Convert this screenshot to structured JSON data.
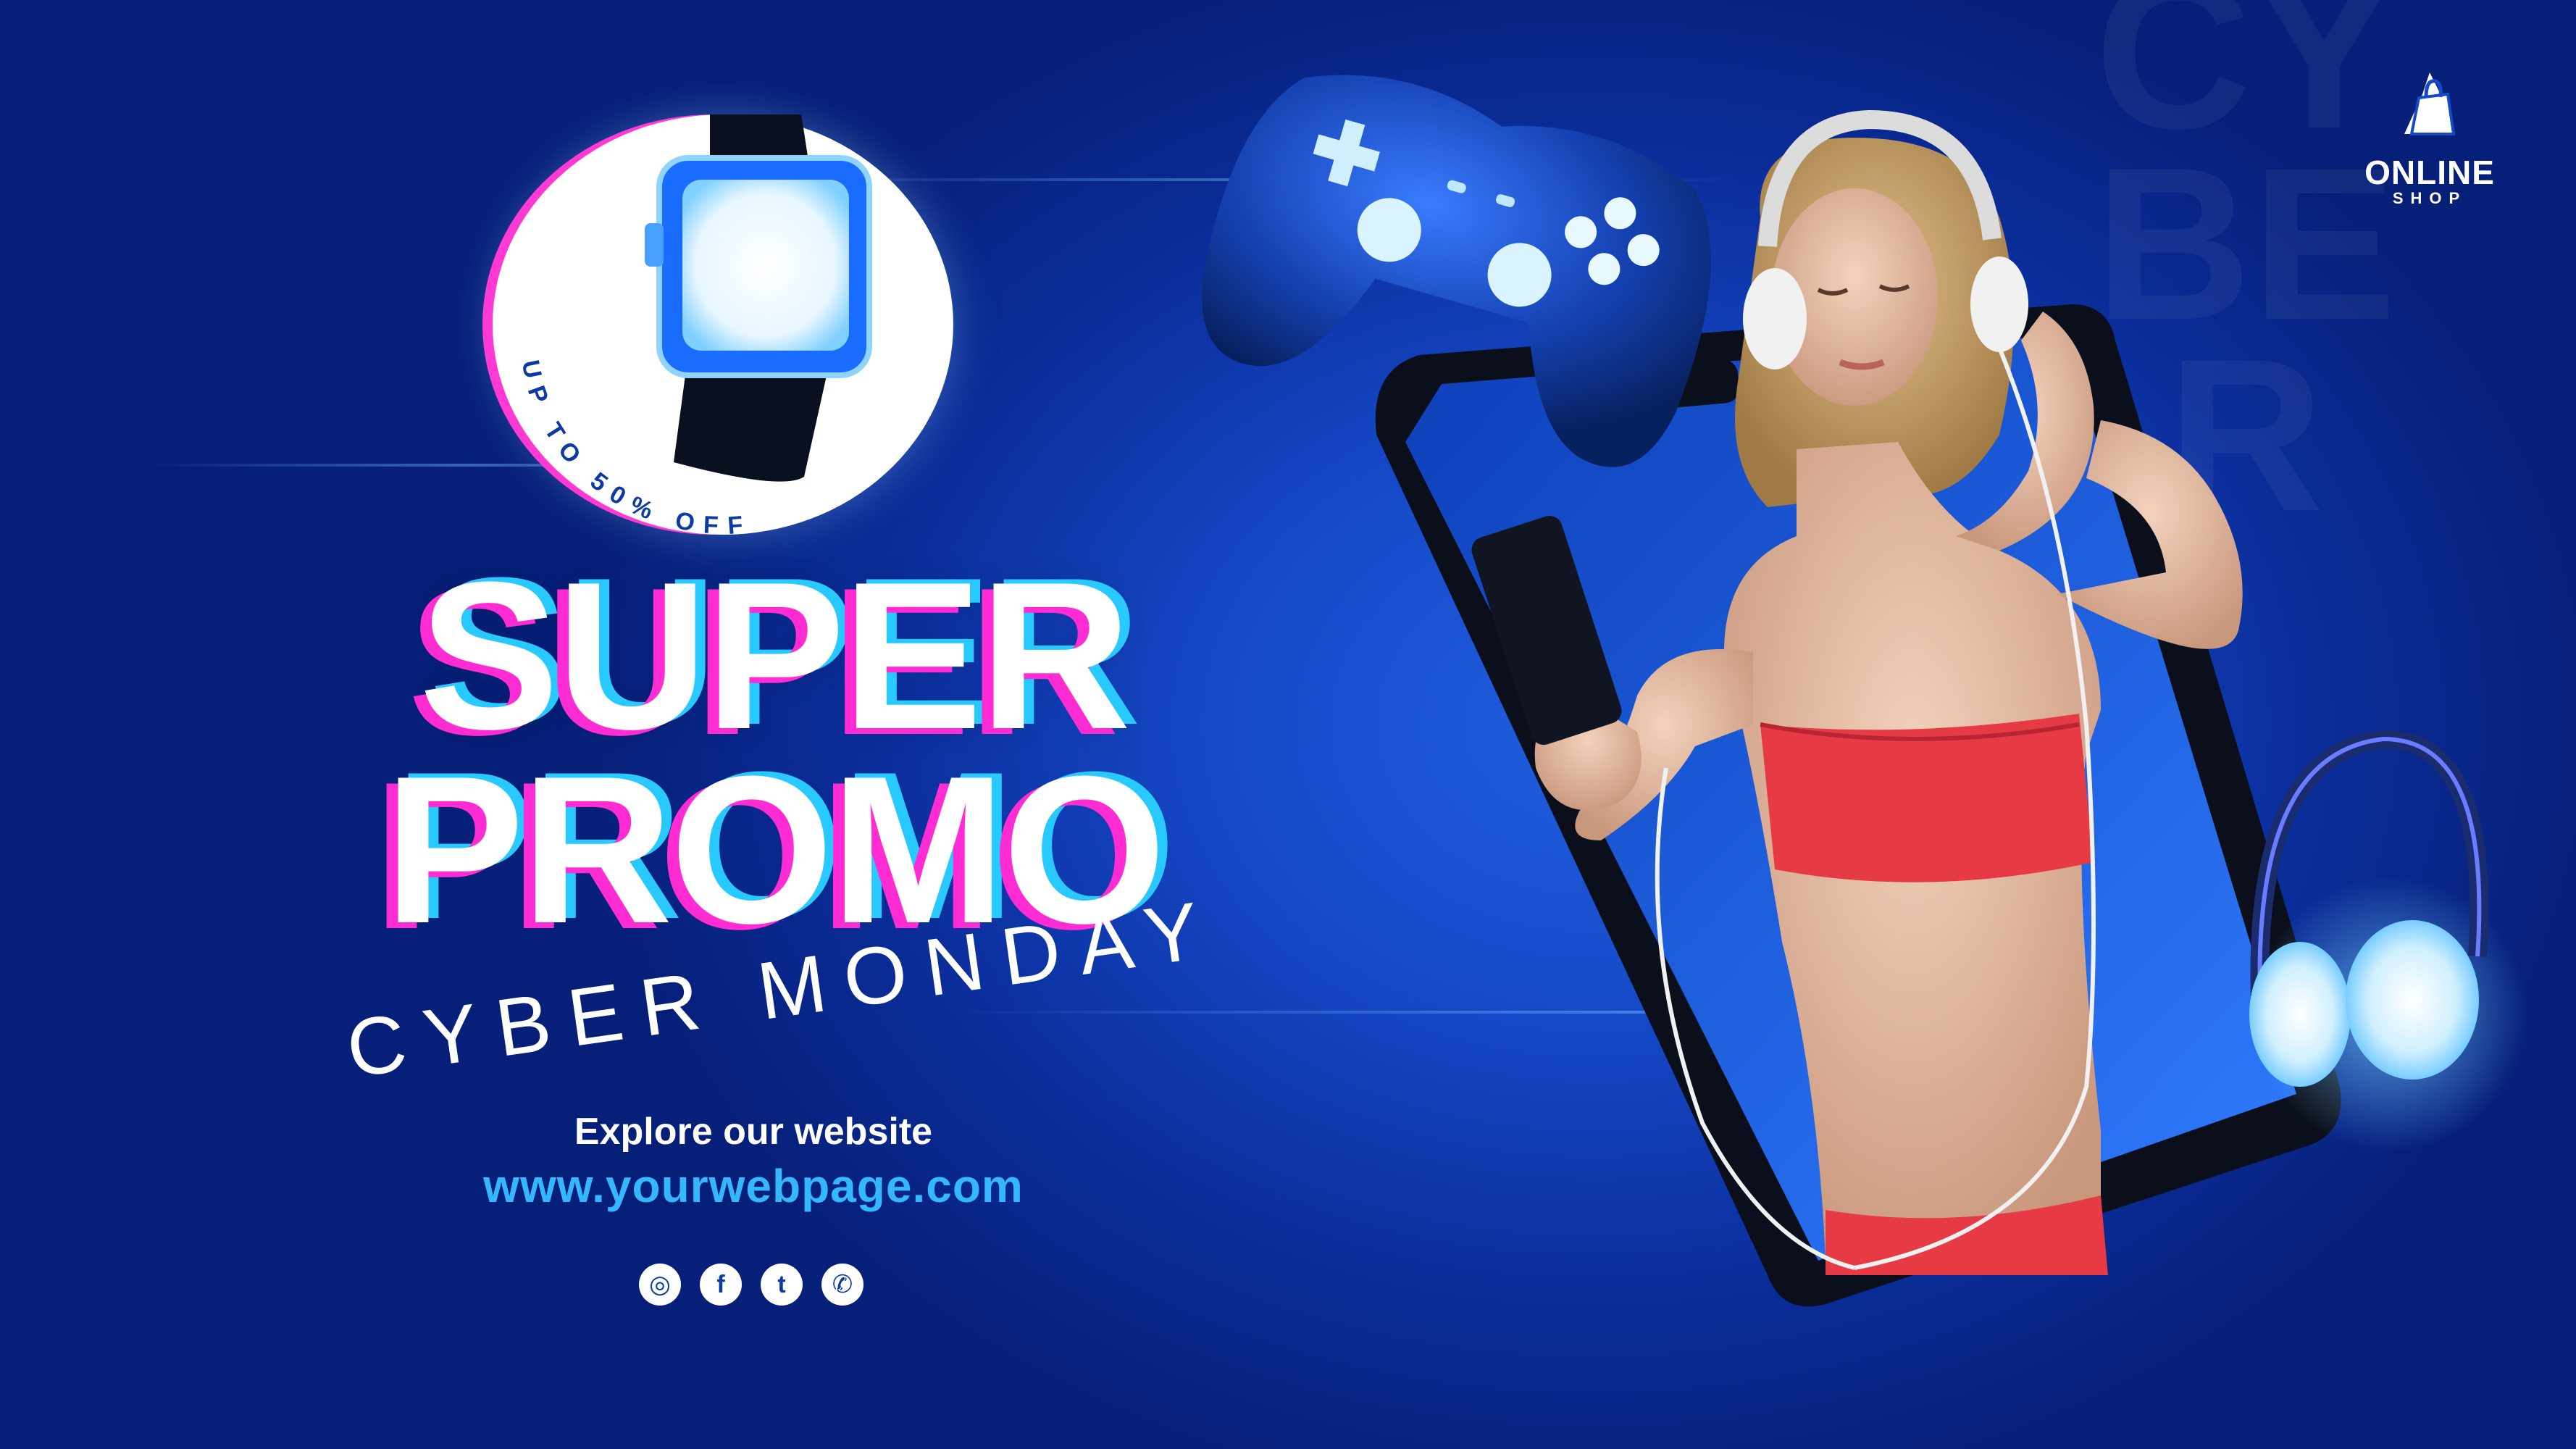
{
  "brand": {
    "name": "ONLINE",
    "sub": "SHOP",
    "logo_icon": "shopping-bag-icon"
  },
  "badge": {
    "text": "UP TO 50% OFF",
    "icon": "smartwatch-icon"
  },
  "headline": {
    "line1": "SUPER",
    "line2": "PROMO",
    "subtitle": "CYBER MONDAY"
  },
  "cta": {
    "explore": "Explore our website",
    "url": "www.yourwebpage.com"
  },
  "socials": [
    {
      "icon": "instagram-icon",
      "glyph": "◎"
    },
    {
      "icon": "facebook-icon",
      "glyph": "f"
    },
    {
      "icon": "twitter-icon",
      "glyph": "t"
    },
    {
      "icon": "whatsapp-icon",
      "glyph": "✆"
    }
  ],
  "background_text": "CYBER",
  "colors": {
    "background": "#1548c6",
    "accent_pink": "#ff2bd3",
    "accent_cyan": "#27c9ff",
    "url": "#34b7ff",
    "top": "#e63a45"
  }
}
